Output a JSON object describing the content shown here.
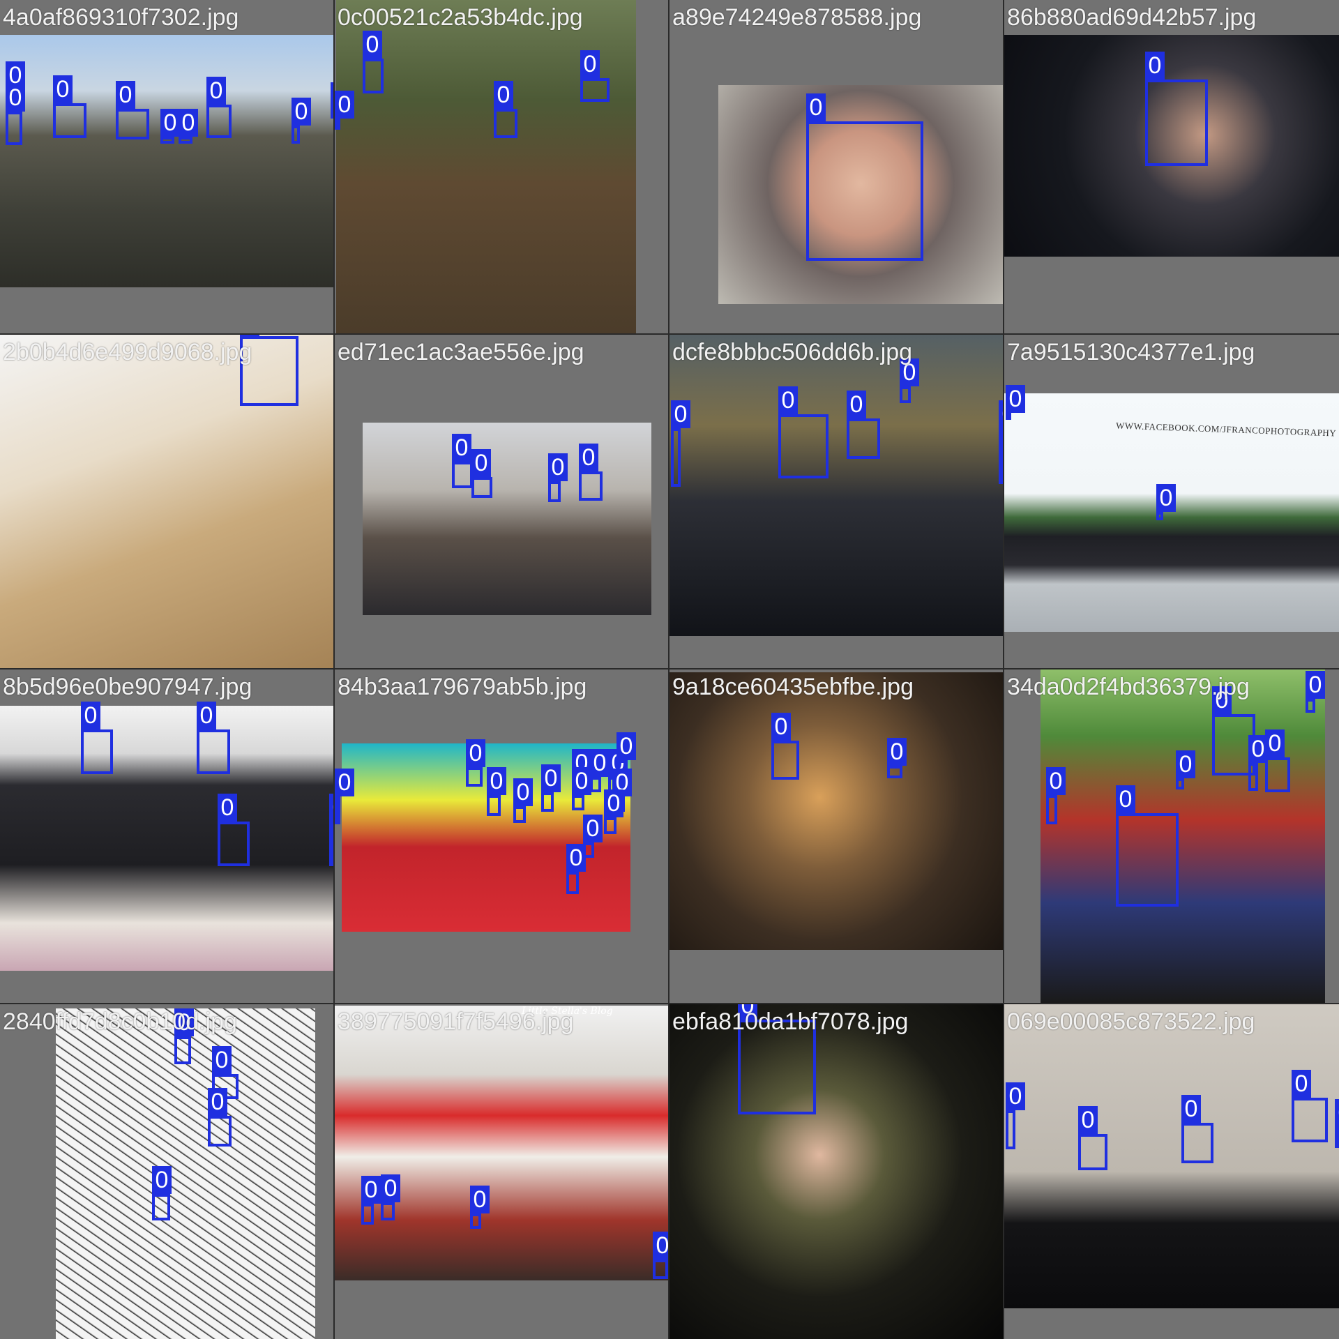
{
  "tiles": [
    {
      "filename": "4a0af869310f7302.jpg",
      "label": "0",
      "boxes": 12
    },
    {
      "filename": "0c00521c2a53b4dc.jpg",
      "label": "0",
      "boxes": 4
    },
    {
      "filename": "a89e74249e878588.jpg",
      "label": "0",
      "boxes": 1
    },
    {
      "filename": "86b880ad69d42b57.jpg",
      "label": "0",
      "boxes": 1
    },
    {
      "filename": "2b0b4d6e499d9068.jpg",
      "label": "0",
      "boxes": 1
    },
    {
      "filename": "ed71ec1ac3ae556e.jpg",
      "label": "0",
      "boxes": 4
    },
    {
      "filename": "dcfe8bbbc506dd6b.jpg",
      "label": "0",
      "boxes": 5
    },
    {
      "filename": "7a9515130c4377e1.jpg",
      "label": "0",
      "boxes": 2
    },
    {
      "filename": "8b5d96e0be907947.jpg",
      "label": "0",
      "boxes": 4
    },
    {
      "filename": "84b3aa179679ab5b.jpg",
      "label": "0",
      "boxes": 14
    },
    {
      "filename": "9a18ce60435ebfbe.jpg",
      "label": "0",
      "boxes": 2
    },
    {
      "filename": "34da0d2f4bd36379.jpg",
      "label": "0",
      "boxes": 7
    },
    {
      "filename": "2840ffd7d8c0b10d.jpg",
      "label": "0",
      "boxes": 4
    },
    {
      "filename": "389775091f7f5496.jpg",
      "label": "0",
      "boxes": 4
    },
    {
      "filename": "ebfa810da1bf7078.jpg",
      "label": "0",
      "boxes": 1
    },
    {
      "filename": "069e00085c873522.jpg",
      "label": "0",
      "boxes": 5
    }
  ],
  "watermarks": {
    "car_photo": "WWW.FACEBOOK.COM/JFRANCOPHOTOGRAPHY",
    "shop_photo": "Little Stella's Blog"
  },
  "colors": {
    "box_border": "#1f2fe0",
    "label_background": "#1f2fe0",
    "label_text": "#ffffff",
    "tile_padding_gray": "#727272",
    "filename_text": "#f2f2f2"
  }
}
